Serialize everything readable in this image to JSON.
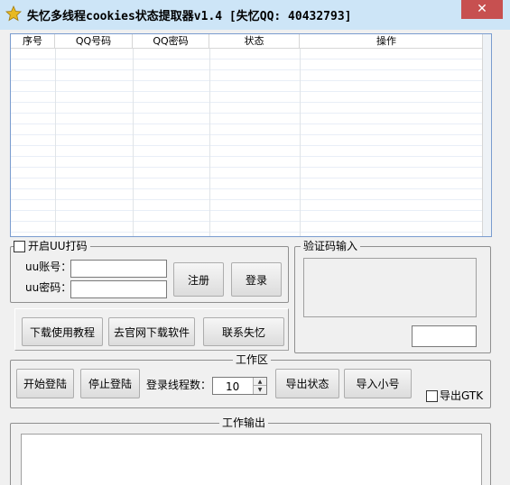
{
  "window": {
    "title": "失忆多线程cookies状态提取器v1.4  [失忆QQ: 40432793]",
    "close_glyph": "✕",
    "accent": "#c75050"
  },
  "grid": {
    "columns": [
      "序号",
      "QQ号码",
      "QQ密码",
      "状态",
      "操作"
    ],
    "rows": []
  },
  "uu": {
    "enable_label": "开启UU打码",
    "account_label": "uu账号：",
    "password_label": "uu密码：",
    "account_value": "",
    "password_value": "",
    "register_label": "注册",
    "login_label": "登录"
  },
  "captcha": {
    "title": "验证码输入",
    "input_value": ""
  },
  "links": {
    "tutorial_label": "下载使用教程",
    "official_label": "去官网下载软件",
    "contact_label": "联系失忆"
  },
  "work": {
    "title": "工作区",
    "start_label": "开始登陆",
    "stop_label": "停止登陆",
    "threads_label": "登录线程数：",
    "threads_value": "10",
    "export_status_label": "导出状态",
    "import_label": "导入小号",
    "export_gtk_label": "导出GTK"
  },
  "output": {
    "title": "工作输出",
    "text": ""
  }
}
